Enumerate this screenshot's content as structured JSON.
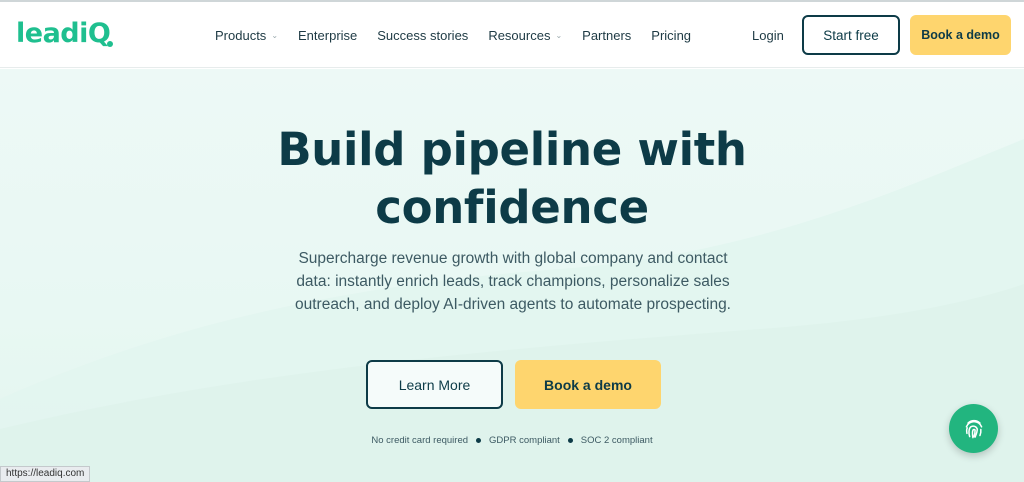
{
  "header": {
    "logo_text": "leadiQ",
    "nav": [
      {
        "label": "Products",
        "dropdown": true
      },
      {
        "label": "Enterprise",
        "dropdown": false
      },
      {
        "label": "Success stories",
        "dropdown": false
      },
      {
        "label": "Resources",
        "dropdown": true
      },
      {
        "label": "Partners",
        "dropdown": false
      },
      {
        "label": "Pricing",
        "dropdown": false
      }
    ],
    "login_label": "Login",
    "start_free_label": "Start free",
    "book_demo_label": "Book a demo"
  },
  "hero": {
    "title_line1": "Build pipeline with",
    "title_line2": "confidence",
    "subtitle": "Supercharge revenue growth with global company and contact data: instantly enrich leads, track champions, personalize sales outreach, and deploy AI-driven agents to automate prospecting.",
    "learn_more_label": "Learn More",
    "book_demo_label": "Book a demo",
    "compliance": [
      "No credit card required",
      "GDPR compliant",
      "SOC 2 compliant"
    ]
  },
  "status_bar": {
    "url": "https://leadiq.com"
  },
  "colors": {
    "brand_green": "#1fbf8f",
    "navy": "#0d3b47",
    "cta_yellow": "#fed56e",
    "hero_bg": "#edf9f6",
    "fab_green": "#22b57f"
  },
  "icons": {
    "chat_button": "fingerprint-icon",
    "dropdown": "chevron-down-icon"
  }
}
